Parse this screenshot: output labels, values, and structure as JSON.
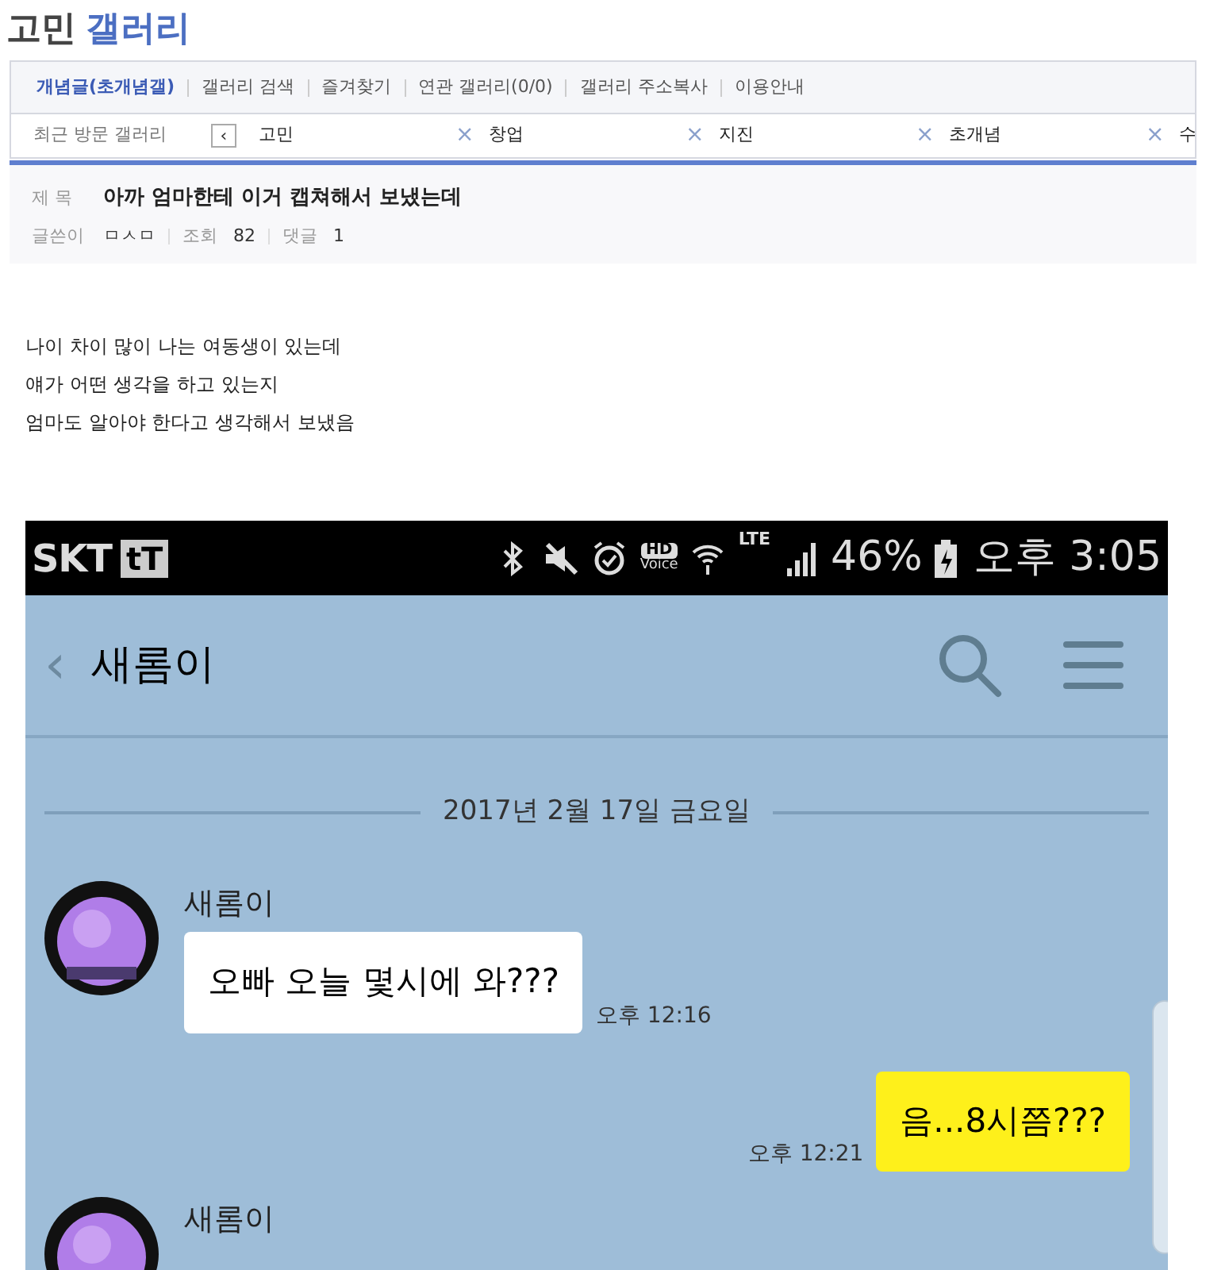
{
  "gallery_title": {
    "name": "고민",
    "suffix": "갤러리"
  },
  "nav": [
    {
      "label": "개념글(초개념갤)",
      "selected": true
    },
    {
      "label": "갤러리 검색",
      "selected": false
    },
    {
      "label": "즐겨찾기",
      "selected": false
    },
    {
      "label": "연관 갤러리(0/0)",
      "selected": false
    },
    {
      "label": "갤러리 주소복사",
      "selected": false
    },
    {
      "label": "이용안내",
      "selected": false
    }
  ],
  "recent": {
    "label": "최근 방문 갤러리",
    "prev": "‹",
    "items": [
      {
        "name": "고민",
        "close": "×"
      },
      {
        "name": "창업",
        "close": "×"
      },
      {
        "name": "지진",
        "close": "×"
      },
      {
        "name": "초개념",
        "close": "×"
      },
      {
        "name": "수"
      }
    ]
  },
  "post": {
    "subject_label": "제 목",
    "title": "아까 엄마한테 이거 캡쳐해서 보냈는데",
    "writer_label": "글쓴이",
    "writer": "ㅁㅅㅁ",
    "views_label": "조회",
    "views": "82",
    "comments_label": "댓글",
    "comments": "1"
  },
  "body": [
    "나이 차이 많이 나는 여동생이 있는데",
    "얘가 어떤 생각을 하고 있는지",
    "엄마도 알아야 한다고 생각해서 보냈음"
  ],
  "phone": {
    "carrier": "SKT",
    "carrier_badge": "tT",
    "hd": "HD",
    "voice": "Voice",
    "lte": "LTE",
    "battery": "46%",
    "time": "오후 3:05",
    "back": "‹",
    "chat_title": "새롬이",
    "date": "2017년 2월 17일 금요일",
    "messages": [
      {
        "kind": "received",
        "sender": "새롬이",
        "text": "오빠 오늘 몇시에 와???",
        "time": "오후 12:16"
      },
      {
        "kind": "sent",
        "text": "음...8시쯤???",
        "time": "오후 12:21"
      },
      {
        "kind": "received",
        "sender": "새롬이"
      }
    ]
  }
}
